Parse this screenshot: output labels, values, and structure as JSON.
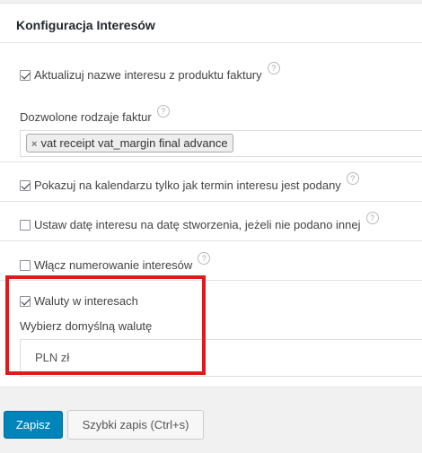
{
  "panel": {
    "title": "Konfiguracja Interesów"
  },
  "settings": {
    "update_name": {
      "label": "Aktualizuj nazwe interesu z produktu faktury",
      "checked": true,
      "help": "?"
    },
    "invoice_types": {
      "label": "Dozwolone rodzaje faktur",
      "help": "?",
      "tag_remove": "×",
      "selected_tag": "vat receipt vat_margin final advance"
    },
    "calendar_only_dated": {
      "label": "Pokazuj na kalendarzu tylko jak termin interesu jest podany",
      "checked": true,
      "help": "?"
    },
    "set_creation_date": {
      "label": "Ustaw datę interesu na datę stworzenia, jeżeli nie podano innej",
      "checked": false,
      "help": "?"
    },
    "numbering": {
      "label": "Włącz numerowanie interesów",
      "checked": false,
      "help": "?"
    },
    "currencies": {
      "label": "Waluty w interesach",
      "checked": true
    },
    "default_currency": {
      "label": "Wybierz domyślną walutę",
      "value": "PLN zł"
    }
  },
  "actions": {
    "save_label": "Zapisz",
    "quick_save_label": "Szybki zapis (Ctrl+s)"
  },
  "colors": {
    "highlight": "#e01a1a",
    "primary": "#0085ba"
  }
}
